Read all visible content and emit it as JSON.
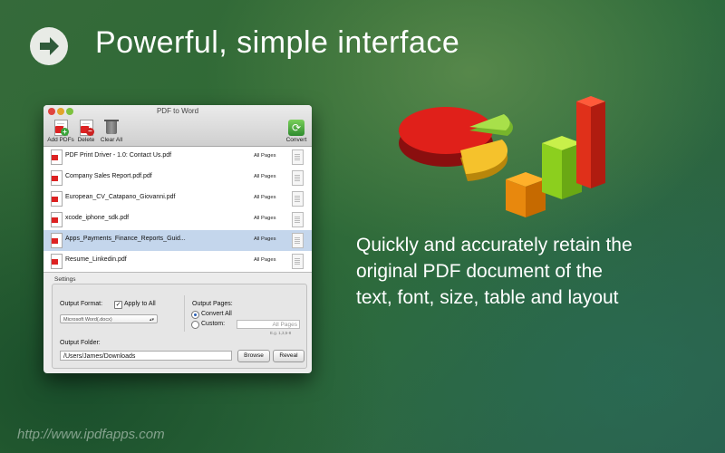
{
  "hero": {
    "title": "Powerful, simple interface",
    "icon": "arrow-right-icon"
  },
  "tagline": [
    "Quickly and accurately retain the",
    "original PDF document of the",
    "text, font, size, table and layout"
  ],
  "watermark": "http://www.ipdfapps.com",
  "window": {
    "title": "PDF to Word",
    "toolbar": {
      "add_label": "Add PDFs",
      "delete_label": "Delete",
      "clear_label": "Clear All",
      "convert_label": "Convert"
    },
    "files": [
      {
        "name": "PDF Print Driver - 1.0: Contact Us.pdf",
        "pages": "All Pages"
      },
      {
        "name": "Company Sales Report.pdf.pdf",
        "pages": "All Pages"
      },
      {
        "name": "European_CV_Catapano_Giovanni.pdf",
        "pages": "All Pages"
      },
      {
        "name": "xcode_iphone_sdk.pdf",
        "pages": "All Pages"
      },
      {
        "name": "Apps_Payments_Finance_Reports_Guid...",
        "pages": "All Pages",
        "selected": true
      },
      {
        "name": "Resume_Linkedin.pdf",
        "pages": "All Pages"
      }
    ],
    "settings": {
      "section_label": "Settings",
      "output_format_label": "Output Format:",
      "apply_all_label": "Apply to All",
      "format_value": "Microsoft Word(.docx)",
      "output_pages_label": "Output Pages:",
      "convert_all_label": "Convert All",
      "custom_label": "Custom:",
      "pages_placeholder": "All Pages",
      "pages_hint": "E.g. 1,3,5-8",
      "output_folder_label": "Output Folder:",
      "folder_value": "/Users/James/Downloads",
      "browse_label": "Browse",
      "reveal_label": "Reveal"
    }
  }
}
